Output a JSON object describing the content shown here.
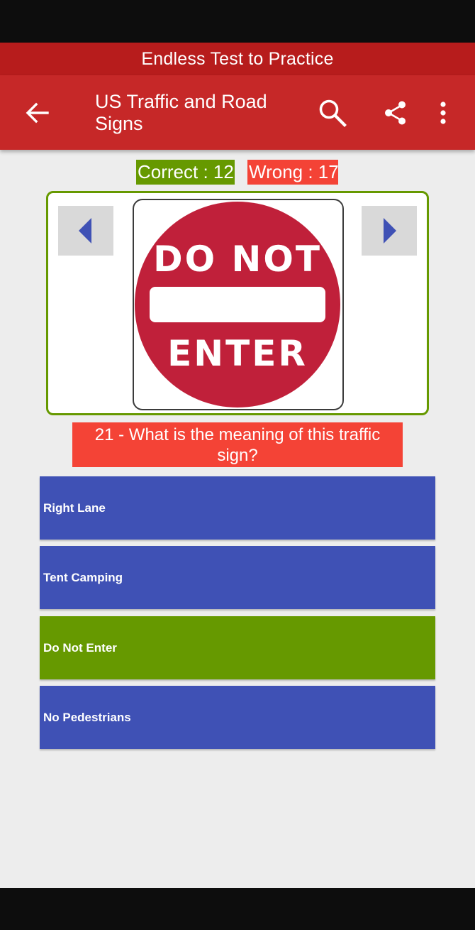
{
  "banner": {
    "text": "Endless Test to Practice"
  },
  "toolbar": {
    "title": "US Traffic and Road Signs",
    "icons": {
      "back": "arrow-back-icon",
      "search": "search-icon",
      "share": "share-icon",
      "more": "more-vert-icon"
    }
  },
  "score": {
    "correct_label": "Correct : 12",
    "wrong_label": "Wrong : 17"
  },
  "sign": {
    "line1": "DO NOT",
    "line2": "ENTER"
  },
  "question": {
    "text": "21 - What is the meaning of this traffic sign?"
  },
  "answers": [
    {
      "label": "Right Lane",
      "color": "#3f51b5"
    },
    {
      "label": "Tent Camping",
      "color": "#3f51b5"
    },
    {
      "label": "Do Not Enter",
      "color": "#669900"
    },
    {
      "label": "No Pedestrians",
      "color": "#3f51b5"
    }
  ],
  "colors": {
    "banner": "#b71c1c",
    "toolbar": "#c62828",
    "correct": "#669900",
    "wrong": "#f44336",
    "answer_default": "#3f51b5",
    "sign_red": "#c0203a",
    "nav_arrow": "#3f51b5"
  }
}
